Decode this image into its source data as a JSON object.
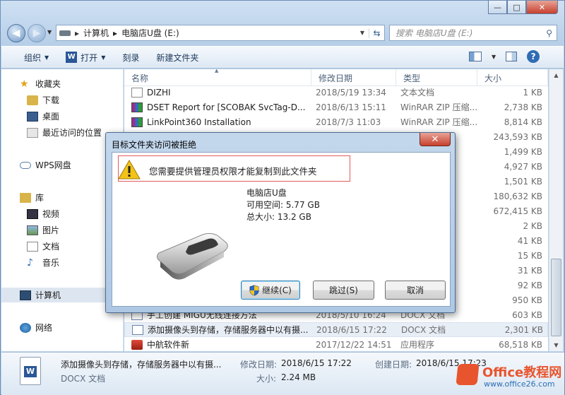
{
  "window": {
    "controls": [
      "—",
      "□",
      "✕"
    ]
  },
  "address": {
    "crumbs": [
      "计算机",
      "电脑店U盘 (E:)"
    ]
  },
  "search": {
    "placeholder": "搜索 电脑店U盘 (E:)"
  },
  "toolbar": {
    "organize": "组织",
    "open": "打开",
    "print": "刻录",
    "new_folder": "新建文件夹"
  },
  "nav": {
    "favorites": "收藏夹",
    "downloads": "下载",
    "desktop": "桌面",
    "recent": "最近访问的位置",
    "wps": "WPS网盘",
    "library": "库",
    "video": "视频",
    "pictures": "图片",
    "docs": "文档",
    "music": "音乐",
    "computer": "计算机",
    "network": "网络"
  },
  "columns": {
    "name": "名称",
    "date": "修改日期",
    "type": "类型",
    "size": "大小"
  },
  "files": [
    {
      "name": "DIZHI",
      "date": "2018/5/19 13:34",
      "type": "文本文档",
      "size": "1 KB",
      "icon": "text-file-icon"
    },
    {
      "name": "DSET Report for [SCOBAK SvcTag-D...",
      "date": "2018/6/13 15:11",
      "type": "WinRAR ZIP 压缩...",
      "size": "2,738 KB",
      "icon": "winrar-icon"
    },
    {
      "name": "LinkPoint360 Installation",
      "date": "2018/7/3 11:03",
      "type": "WinRAR ZIP 压缩...",
      "size": "8,814 KB",
      "icon": "winrar-icon"
    },
    {
      "name": "",
      "date": "",
      "type": "",
      "size": "243,593 KB",
      "icon": ""
    },
    {
      "name": "",
      "date": "",
      "type": "",
      "size": "1,499 KB",
      "icon": ""
    },
    {
      "name": "",
      "date": "",
      "type": "",
      "size": "4,927 KB",
      "icon": ""
    },
    {
      "name": "",
      "date": "",
      "type": "文件",
      "size": "1,501 KB",
      "icon": ""
    },
    {
      "name": "",
      "date": "",
      "type": "压缩...",
      "size": "180,632 KB",
      "icon": ""
    },
    {
      "name": "",
      "date": "",
      "type": "件",
      "size": "672,415 KB",
      "icon": ""
    },
    {
      "name": "",
      "date": "",
      "type": "",
      "size": "2 KB",
      "icon": ""
    },
    {
      "name": "",
      "date": "",
      "type": "",
      "size": "41 KB",
      "icon": ""
    },
    {
      "name": "",
      "date": "",
      "type": "",
      "size": "15 KB",
      "icon": ""
    },
    {
      "name": "",
      "date": "",
      "type": "",
      "size": "31 KB",
      "icon": ""
    },
    {
      "name": "",
      "date": "",
      "type": "",
      "size": "92 KB",
      "icon": ""
    },
    {
      "name": "",
      "date": "",
      "type": "",
      "size": "950 KB",
      "icon": ""
    },
    {
      "name": "手工创建 MIGU无线连接方法",
      "date": "2018/5/10 16:24",
      "type": "DOCX 文档",
      "size": "603 KB",
      "icon": "docx-icon"
    },
    {
      "name": "添加摄像头到存储，存储服务器中以有摄...",
      "date": "2018/6/15 17:22",
      "type": "DOCX 文档",
      "size": "2,301 KB",
      "icon": "docx-icon"
    },
    {
      "name": "中航软件新",
      "date": "2017/12/22 14:51",
      "type": "应用程序",
      "size": "68,518 KB",
      "icon": "app-icon"
    }
  ],
  "details": {
    "name": "添加摄像头到存储，存储服务器中以有摄...",
    "type": "DOCX 文档",
    "modified_label": "修改日期:",
    "modified": "2018/6/15 17:22",
    "size_label": "大小:",
    "size": "2.24 MB",
    "created_label": "创建日期:",
    "created": "2018/6/15 17:23"
  },
  "dialog": {
    "title": "目标文件夹访问被拒绝",
    "message": "您需要提供管理员权限才能复制到此文件夹",
    "drive_name": "电脑店U盘",
    "free_space": "可用空间: 5.77 GB",
    "total_size": "总大小: 13.2 GB",
    "continue": "继续(C)",
    "skip": "跳过(S)",
    "cancel": "取消"
  },
  "watermark": {
    "brand": "Office教程网",
    "url": "www.office26.com"
  }
}
